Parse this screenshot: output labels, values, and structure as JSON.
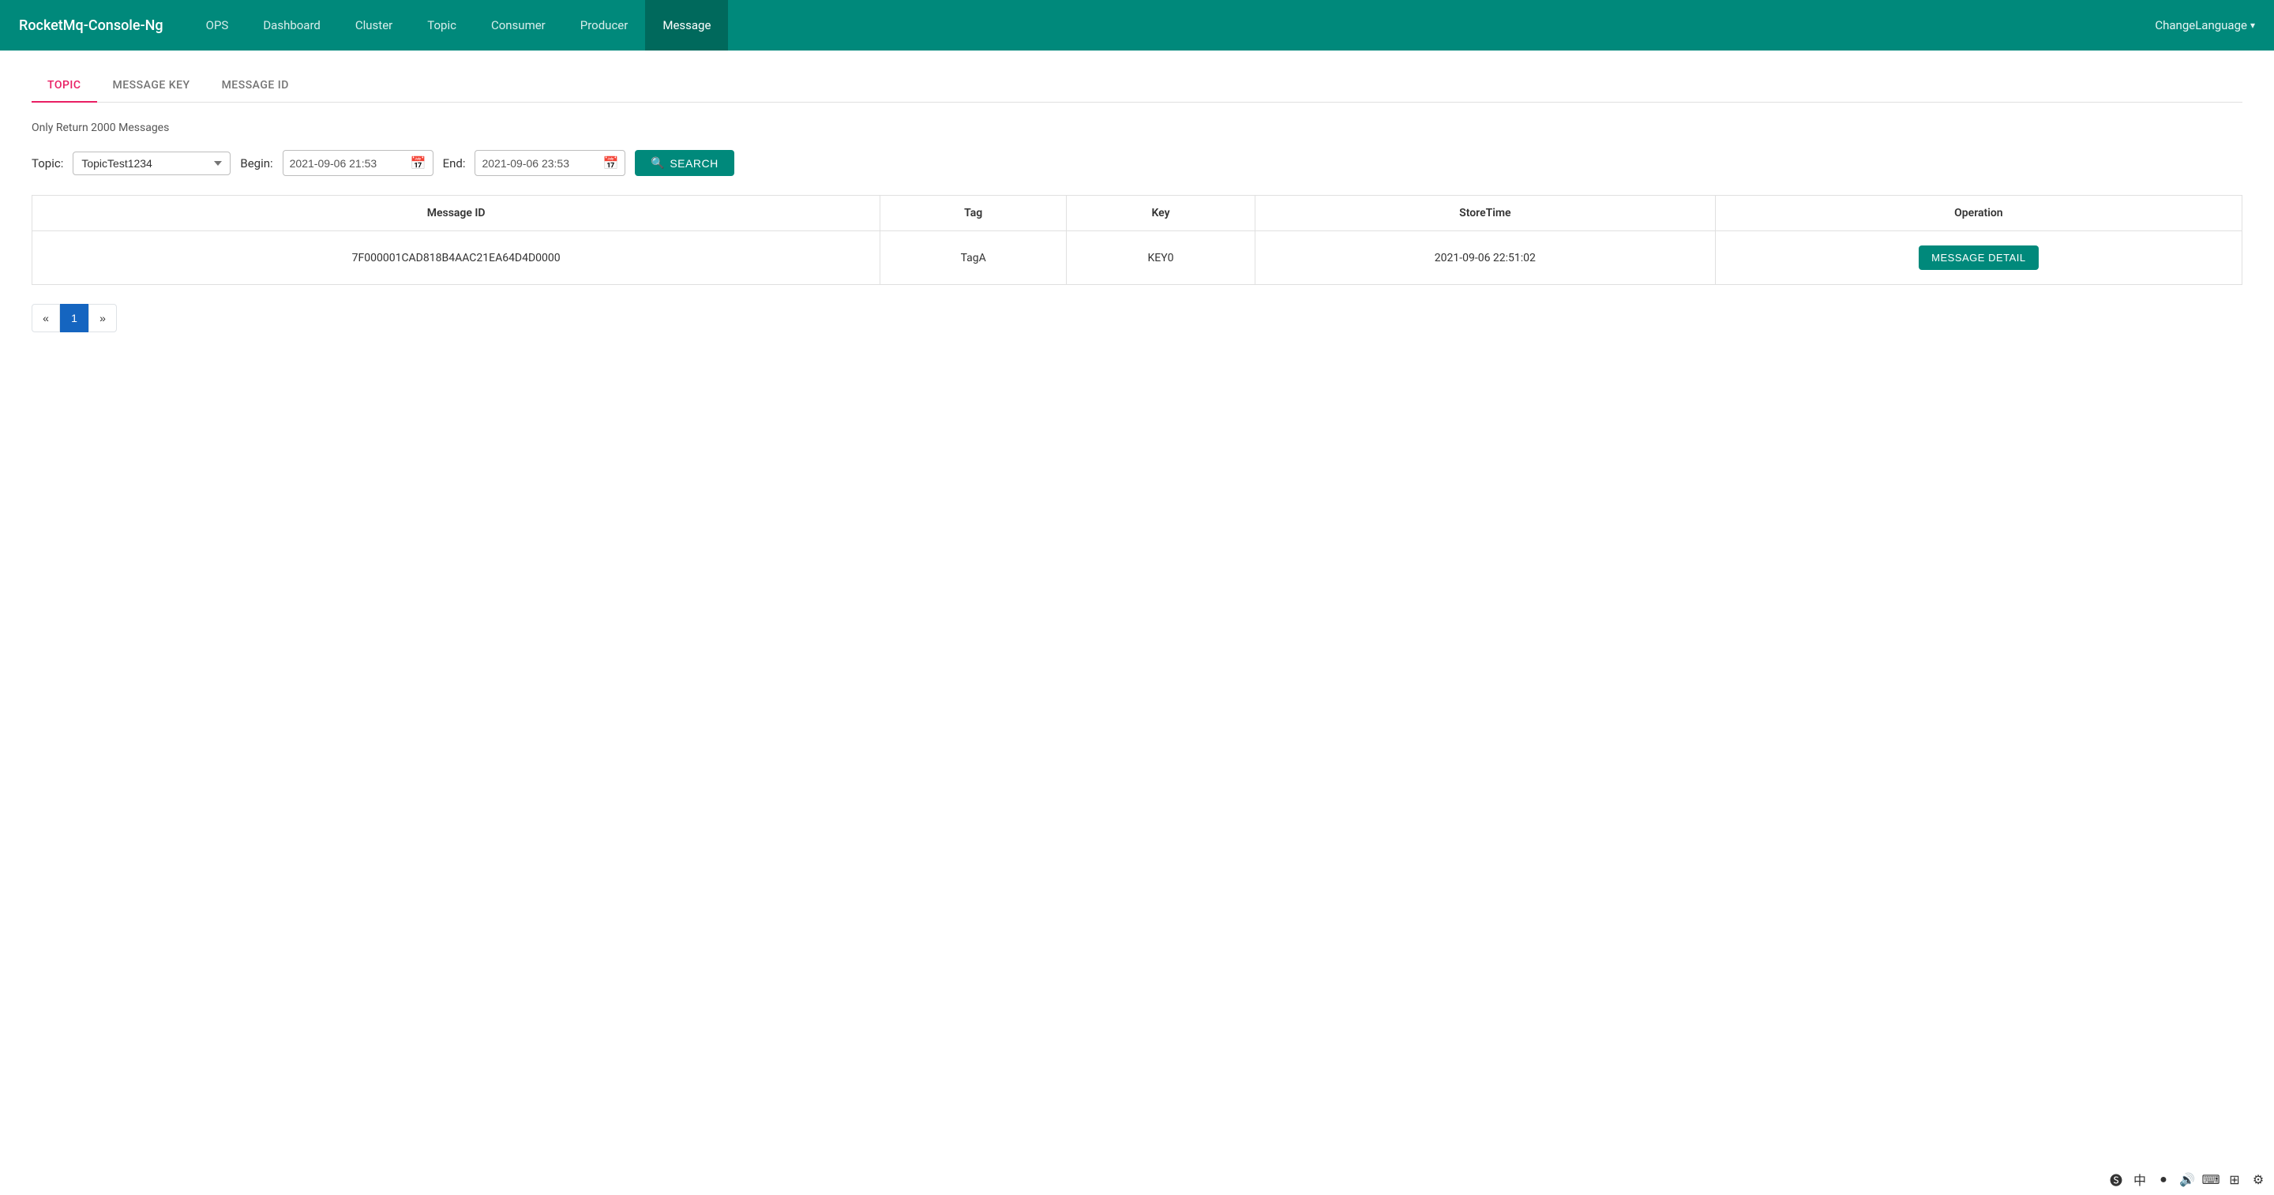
{
  "navbar": {
    "brand": "RocketMq-Console-Ng",
    "nav_items": [
      {
        "label": "OPS",
        "active": false
      },
      {
        "label": "Dashboard",
        "active": false
      },
      {
        "label": "Cluster",
        "active": false
      },
      {
        "label": "Topic",
        "active": false
      },
      {
        "label": "Consumer",
        "active": false
      },
      {
        "label": "Producer",
        "active": false
      },
      {
        "label": "Message",
        "active": true
      }
    ],
    "change_language": "ChangeLanguage"
  },
  "tabs": [
    {
      "label": "TOPIC",
      "active": true
    },
    {
      "label": "MESSAGE KEY",
      "active": false
    },
    {
      "label": "MESSAGE ID",
      "active": false
    }
  ],
  "info_text": "Only Return 2000 Messages",
  "search_form": {
    "topic_label": "Topic:",
    "topic_value": "TopicTest1234",
    "begin_label": "Begin:",
    "begin_value": "2021-09-06 21:53",
    "end_label": "End:",
    "end_value": "2021-09-06 23:53",
    "search_button": "SEARCH"
  },
  "table": {
    "headers": [
      "Message ID",
      "Tag",
      "Key",
      "StoreTime",
      "Operation"
    ],
    "rows": [
      {
        "message_id": "7F000001CAD818B4AAC21EA64D4D0000",
        "tag": "TagA",
        "key": "KEY0",
        "store_time": "2021-09-06 22:51:02",
        "operation": "MESSAGE DETAIL"
      }
    ]
  },
  "pagination": {
    "prev": "«",
    "current": "1",
    "next": "»"
  },
  "colors": {
    "primary": "#00897b",
    "active_tab": "#e91e63",
    "active_page": "#1565c0"
  }
}
